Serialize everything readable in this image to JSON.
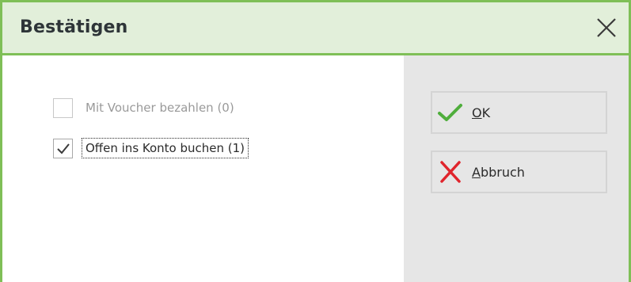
{
  "dialog": {
    "title": "Bestätigen"
  },
  "options": [
    {
      "label": "Mit Voucher bezahlen (0)",
      "checked": false,
      "enabled": false
    },
    {
      "label": "Offen ins Konto buchen (1)",
      "checked": true,
      "enabled": true
    }
  ],
  "buttons": {
    "ok": {
      "accel": "O",
      "rest": "K",
      "icon": "checkmark-icon"
    },
    "cancel": {
      "accel": "A",
      "rest": "bbruch",
      "icon": "x-icon"
    }
  },
  "colors": {
    "accent_green": "#7fbf57",
    "title_bar_bg": "#e2efda",
    "ok_green": "#4fae3c",
    "cancel_red": "#e0242c",
    "right_pane_bg": "#e6e6e6"
  }
}
